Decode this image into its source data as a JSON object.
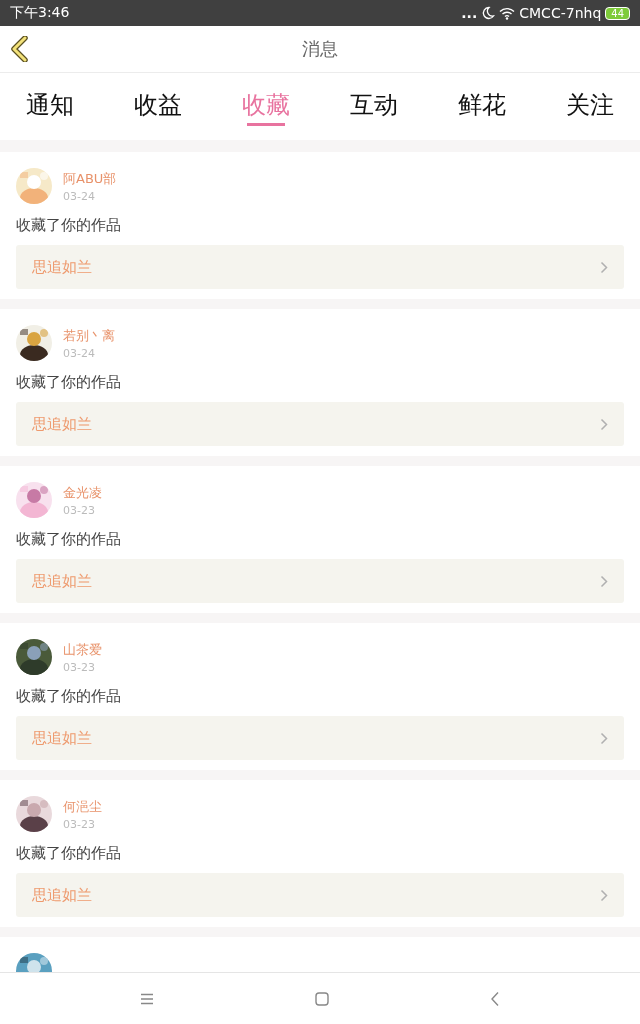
{
  "status_bar": {
    "time": "下午3:46",
    "dots": "...",
    "network": "CMCC-7nhq",
    "battery": "44"
  },
  "header": {
    "title": "消息"
  },
  "tabs": [
    {
      "label": "通知",
      "selected": false
    },
    {
      "label": "收益",
      "selected": false
    },
    {
      "label": "收藏",
      "selected": true
    },
    {
      "label": "互动",
      "selected": false
    },
    {
      "label": "鲜花",
      "selected": false
    },
    {
      "label": "关注",
      "selected": false
    }
  ],
  "messages": [
    {
      "user": "阿ABU部",
      "date": "03-24",
      "text": "收藏了你的作品",
      "work": "思追如兰"
    },
    {
      "user": "若别丶离",
      "date": "03-24",
      "text": "收藏了你的作品",
      "work": "思追如兰"
    },
    {
      "user": "金光凌",
      "date": "03-23",
      "text": "收藏了你的作品",
      "work": "思追如兰"
    },
    {
      "user": "山茶爱",
      "date": "03-23",
      "text": "收藏了你的作品",
      "work": "思追如兰"
    },
    {
      "user": "何浥尘",
      "date": "03-23",
      "text": "收藏了你的作品",
      "work": "思追如兰"
    },
    {
      "avatar": true
    }
  ]
}
